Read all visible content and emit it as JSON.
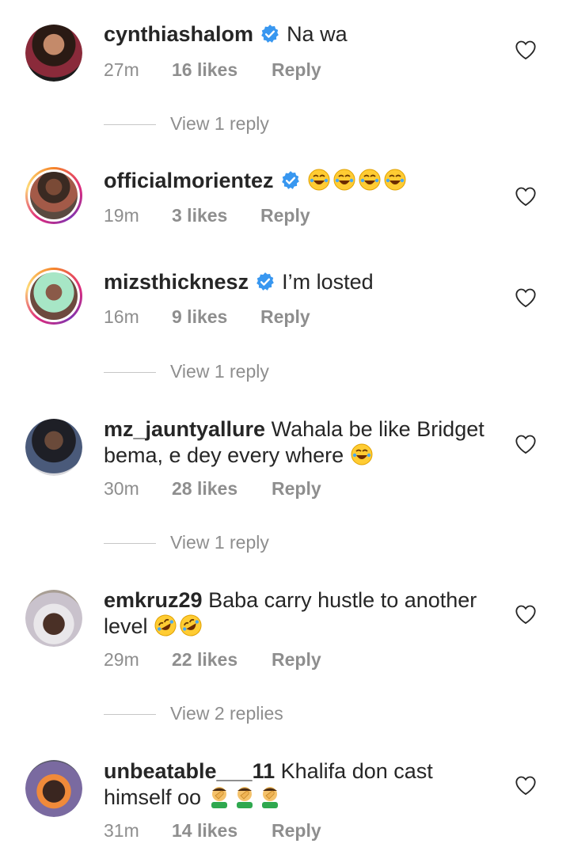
{
  "comments": [
    {
      "username": "cynthiashalom",
      "verified": true,
      "text": "Na wa",
      "emojis": [],
      "time": "27m",
      "likes": "16 likes",
      "reply_label": "Reply",
      "view_replies": "View 1 reply",
      "story_ring": false,
      "avatar_color": "#5a3b2e"
    },
    {
      "username": "officialmorientez",
      "verified": true,
      "text": "",
      "emojis": [
        "joy-emoji",
        "joy-emoji",
        "joy-emoji",
        "joy-emoji"
      ],
      "time": "19m",
      "likes": "3 likes",
      "reply_label": "Reply",
      "story_ring": true,
      "avatar_color": "#6b4a3a"
    },
    {
      "username": "mizsthicknesz",
      "verified": true,
      "text": "I’m losted",
      "emojis": [],
      "time": "16m",
      "likes": "9 likes",
      "reply_label": "Reply",
      "view_replies": "View 1 reply",
      "story_ring": true,
      "avatar_color": "#8fd3b0"
    },
    {
      "username": "mz_jauntyallure",
      "verified": false,
      "text": "Wahala be like Bridget bema, e dey every where",
      "emojis": [
        "joy-emoji"
      ],
      "time": "30m",
      "likes": "28 likes",
      "reply_label": "Reply",
      "view_replies": "View 1 reply",
      "story_ring": false,
      "avatar_color": "#3b3f4a"
    },
    {
      "username": "emkruz29",
      "verified": false,
      "text": "Baba carry hustle to another level",
      "emojis": [
        "rofl-emoji",
        "rofl-emoji"
      ],
      "time": "29m",
      "likes": "22 likes",
      "reply_label": "Reply",
      "view_replies": "View 2 replies",
      "story_ring": false,
      "avatar_color": "#b9a796"
    },
    {
      "username": "unbeatable___11",
      "verified": false,
      "text": "Khalifa don cast himself oo",
      "emojis": [
        "facepalm-emoji",
        "facepalm-emoji",
        "facepalm-emoji"
      ],
      "time": "31m",
      "likes": "14 likes",
      "reply_label": "Reply",
      "story_ring": false,
      "avatar_color": "#6c5a8a"
    }
  ],
  "colors": {
    "text": "#262626",
    "meta": "#8e8e8e",
    "verified": "#3897f0",
    "divider": "#c7c7c7"
  },
  "icons": {
    "verified": "verified-badge-icon",
    "like": "heart-outline-icon"
  }
}
